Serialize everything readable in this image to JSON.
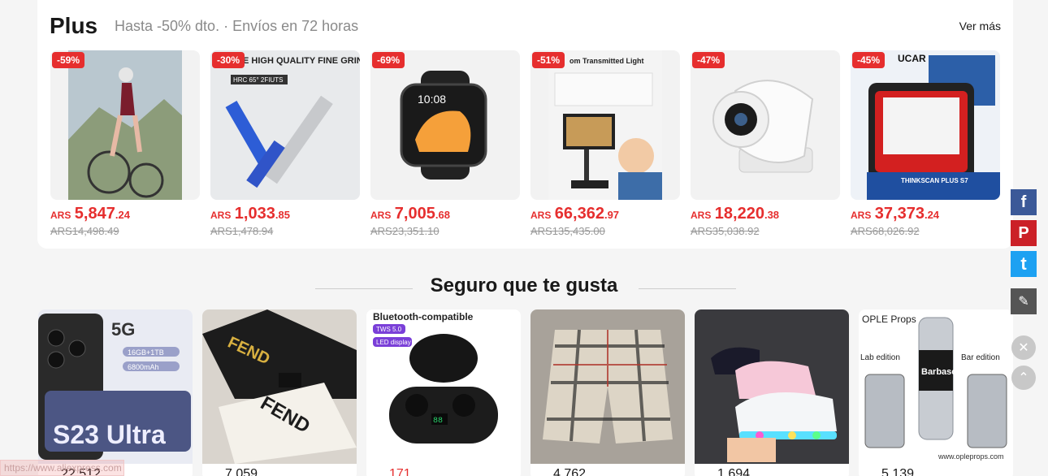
{
  "plus": {
    "title": "Plus",
    "subtitle": "Hasta -50% dto. · Envíos en 72 horas",
    "see_more": "Ver más",
    "products": [
      {
        "discount": "-59%",
        "currency": "ARS",
        "price_int": "5,847",
        "price_dec": ".24",
        "old_price": "ARS14,498.49"
      },
      {
        "discount": "-30%",
        "currency": "ARS",
        "price_int": "1,033",
        "price_dec": ".85",
        "old_price": "ARS1,478.94"
      },
      {
        "discount": "-69%",
        "currency": "ARS",
        "price_int": "7,005",
        "price_dec": ".68",
        "old_price": "ARS23,351.10"
      },
      {
        "discount": "-51%",
        "currency": "ARS",
        "price_int": "66,362",
        "price_dec": ".97",
        "old_price": "ARS135,435.00"
      },
      {
        "discount": "-47%",
        "currency": "ARS",
        "price_int": "18,220",
        "price_dec": ".38",
        "old_price": "ARS35,038.92"
      },
      {
        "discount": "-45%",
        "currency": "ARS",
        "price_int": "37,373",
        "price_dec": ".24",
        "old_price": "ARS68,026.92"
      }
    ],
    "product_image_texts": {
      "p2": "E HIGH QUALITY FINE GRINDING",
      "p2_sub": "HRC 65°  2FIUTS",
      "p4": "om Transmitted Light",
      "p6_brand": "UCAR",
      "p6_tag": "THINKSCAN PLUS S7",
      "watch_time": "10:08"
    }
  },
  "recommend": {
    "title": "Seguro que te gusta",
    "tiles": [
      {
        "count": "22,512",
        "img_text": "S23 Ultra",
        "img_badge": "5G",
        "img_specs": [
          "16GB+1TB",
          "6800mAh"
        ]
      },
      {
        "count": "7,059",
        "img_text": "FEND"
      },
      {
        "count": "171",
        "img_text": "Bluetooth-compatible",
        "img_tags": [
          "TWS 5.0",
          "LED display"
        ]
      },
      {
        "count": "4,762",
        "img_text": ""
      },
      {
        "count": "1,694",
        "img_text": ""
      },
      {
        "count": "5,139",
        "img_text": "OPLE Props",
        "img_labels": [
          "Lab edition",
          "Bar edition",
          "Barbasol",
          "www.opleprops.com"
        ]
      }
    ]
  },
  "social": {
    "facebook": "f",
    "pinterest": "P",
    "twitter": "t",
    "edit": "✎",
    "close": "✕",
    "up": "⌃"
  },
  "status_url": "https://www.aliexpress.com",
  "colors": {
    "accent": "#e62e2e",
    "facebook": "#3b5998",
    "pinterest": "#cb2027",
    "twitter": "#1da1f2",
    "edit": "#555555"
  }
}
